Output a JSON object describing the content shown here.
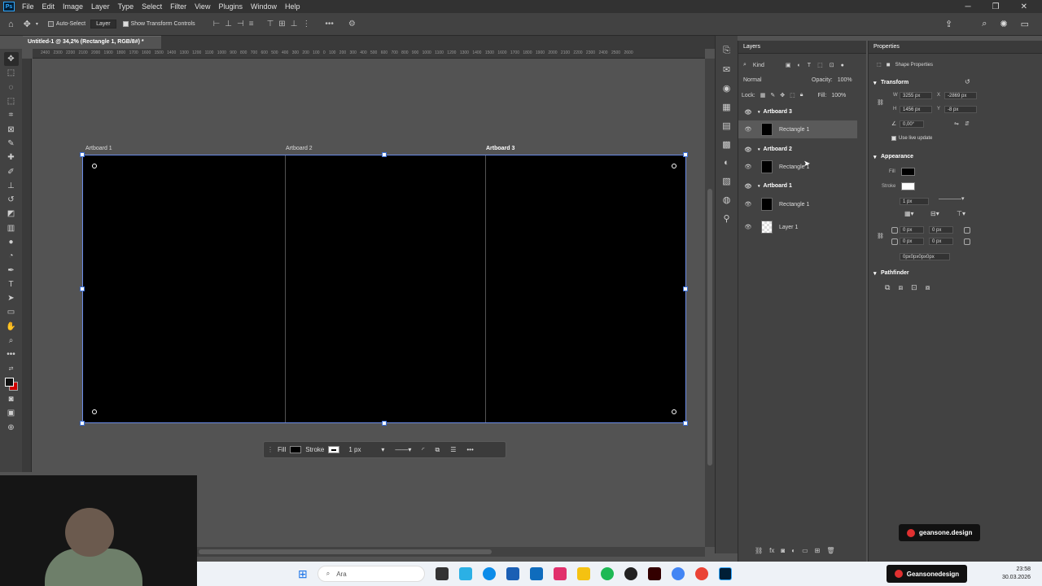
{
  "menu": {
    "logo": "Ps",
    "items": [
      "File",
      "Edit",
      "Image",
      "Layer",
      "Type",
      "Select",
      "Filter",
      "View",
      "Plugins",
      "Window",
      "Help"
    ]
  },
  "options": {
    "auto_select": "Auto-Select",
    "target": "Layer",
    "show_transform": "Show Transform Controls"
  },
  "document": {
    "tab_title": "Untitled-1 @ 34,2% (Rectangle 1, RGB/8#) *"
  },
  "ruler": {
    "marks": "2400  2300  2200  2100  2000  1900  1800  1700  1600  1500  1400  1300  1200  1100  1000  900  800  700  600  500  400  300  200  100  0  100  200  300  400  500  600  700  800  900  1000  1100  1200  1300  1400  1500  1600  1700  1800  1900  2000  2100  2200  2300  2400  2500  2600"
  },
  "artboards": [
    {
      "label": "Artboard 1"
    },
    {
      "label": "Artboard 2"
    },
    {
      "label": "Artboard 3"
    }
  ],
  "contextual_bar": {
    "fill_label": "Fill",
    "stroke_label": "Stroke",
    "stroke_width": "1 px"
  },
  "layers_panel": {
    "title": "Layers",
    "filter_kind": "Kind",
    "blend_mode": "Normal",
    "opacity_label": "Opacity:",
    "opacity_value": "100%",
    "lock_label": "Lock:",
    "fill_label": "Fill:",
    "fill_value": "100%",
    "layers": [
      {
        "name": "Artboard 3",
        "type": "group"
      },
      {
        "name": "Rectangle 1",
        "type": "shape",
        "selected": true
      },
      {
        "name": "Artboard 2",
        "type": "group"
      },
      {
        "name": "Rectangle 1",
        "type": "shape"
      },
      {
        "name": "Artboard 1",
        "type": "group"
      },
      {
        "name": "Rectangle 1",
        "type": "shape"
      },
      {
        "name": "Layer 1",
        "type": "pixel"
      }
    ]
  },
  "properties_panel": {
    "title": "Properties",
    "subtitle": "Shape Properties",
    "transform_title": "Transform",
    "w_label": "W",
    "w_value": "3255 px",
    "x_label": "X",
    "x_value": "-2869 px",
    "h_label": "H",
    "h_value": "1456 px",
    "y_label": "Y",
    "y_value": "-8 px",
    "angle_value": "0,00°",
    "live_update": "Use live update",
    "appearance_title": "Appearance",
    "fill_label": "Fill",
    "stroke_label": "Stroke",
    "stroke_width": "1 px",
    "corner_tl": "0 px",
    "corner_tr": "0 px",
    "corner_bl": "0 px",
    "corner_br": "0 px",
    "corner_summary": "0px0px0px0px",
    "pathfinder_title": "Pathfinder"
  },
  "watermarks": {
    "upper": "geansone.design",
    "lower": "Geansonedesign"
  },
  "taskbar": {
    "search_placeholder": "Ara",
    "time": "23:58",
    "date": "30.03.2026"
  },
  "colors": {
    "accent": "#31a8ff",
    "selection": "#6b8ce8",
    "background_swatch": "#d00000"
  }
}
